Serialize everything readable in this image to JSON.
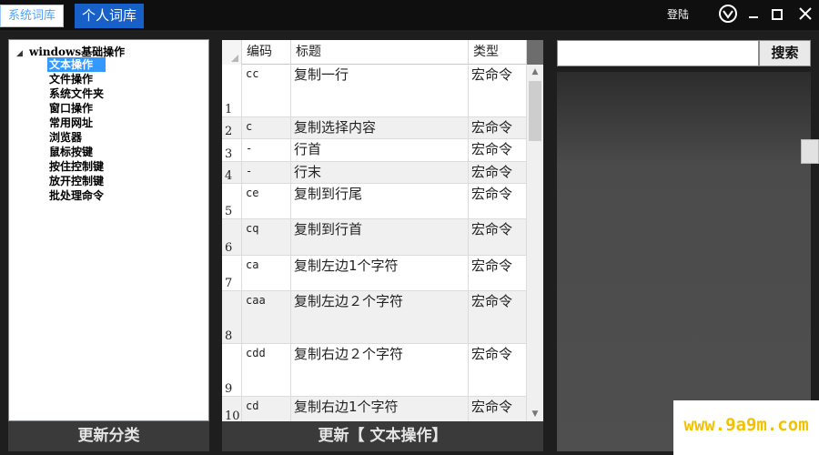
{
  "titlebar": {
    "tab_system": "系统词库",
    "tab_personal": "个人词库",
    "login": "登陆",
    "icons": [
      "logo-icon",
      "minimize-icon",
      "maximize-icon",
      "close-icon"
    ]
  },
  "tree": {
    "root": "windows基础操作",
    "items": [
      {
        "label": "文本操作",
        "selected": true
      },
      {
        "label": "文件操作"
      },
      {
        "label": "系统文件夹"
      },
      {
        "label": "窗口操作"
      },
      {
        "label": "常用网址"
      },
      {
        "label": "浏览器"
      },
      {
        "label": "鼠标按键"
      },
      {
        "label": "按住控制键"
      },
      {
        "label": "放开控制键"
      },
      {
        "label": "批处理命令"
      }
    ]
  },
  "grid": {
    "columns": {
      "code": "编码",
      "title": "标题",
      "type": "类型"
    },
    "rows": [
      {
        "num": "1",
        "code": "cc",
        "title": "复制一行",
        "type": "宏命令"
      },
      {
        "num": "2",
        "code": "c",
        "title": "复制选择内容",
        "type": "宏命令"
      },
      {
        "num": "3",
        "code": "-",
        "title": "行首",
        "type": "宏命令"
      },
      {
        "num": "4",
        "code": "-",
        "title": "行末",
        "type": "宏命令"
      },
      {
        "num": "5",
        "code": "ce",
        "title": "复制到行尾",
        "type": "宏命令"
      },
      {
        "num": "6",
        "code": "cq",
        "title": "复制到行首",
        "type": "宏命令"
      },
      {
        "num": "7",
        "code": "ca",
        "title": "复制左边1个字符",
        "type": "宏命令"
      },
      {
        "num": "8",
        "code": "caa",
        "title": "复制左边２个字符",
        "type": "宏命令"
      },
      {
        "num": "9",
        "code": "cdd",
        "title": "复制右边２个字符",
        "type": "宏命令"
      },
      {
        "num": "10",
        "code": "cd",
        "title": "复制右边1个字符",
        "type": "宏命令"
      }
    ]
  },
  "buttons": {
    "update_category": "更新分类",
    "update_text": "更新【 文本操作】"
  },
  "search": {
    "value": "",
    "button": "搜索"
  },
  "watermark": "www.9a9m.com"
}
